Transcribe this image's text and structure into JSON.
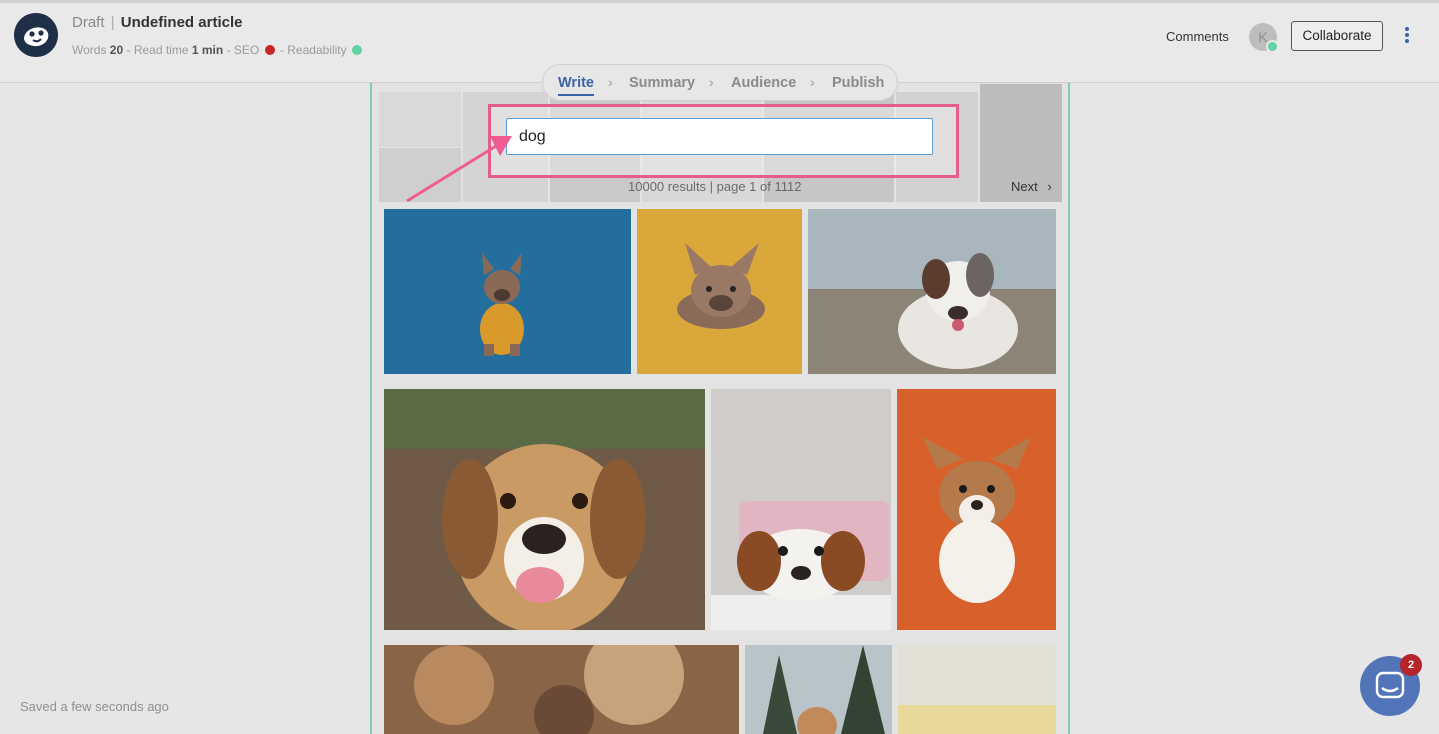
{
  "header": {
    "status": "Draft",
    "separator": "|",
    "article_title": "Undefined article",
    "words_label": "Words",
    "words_value": "20",
    "read_label": "- Read time",
    "read_value": "1 min",
    "seo_label": "- SEO",
    "readability_label": "- Readability",
    "seo_color": "#c62828",
    "readability_color": "#5fd3a3",
    "comments_label": "Comments",
    "avatar_initial": "K",
    "collaborate_label": "Collaborate"
  },
  "stepper": {
    "steps": [
      "Write",
      "Summary",
      "Audience",
      "Publish"
    ],
    "active": "Write",
    "chevron": "›"
  },
  "search": {
    "value": "dog",
    "results_text": "10000 results | page 1 of 1112",
    "next_label": "Next",
    "next_chevron": "›"
  },
  "footer": {
    "saved_text": "Saved a few seconds ago"
  },
  "chat": {
    "badge_count": "2"
  },
  "colors": {
    "accent": "#3a63a7",
    "highlight": "#e55d8d",
    "editor_border": "#7fcfae",
    "chat": "#5274b8"
  }
}
